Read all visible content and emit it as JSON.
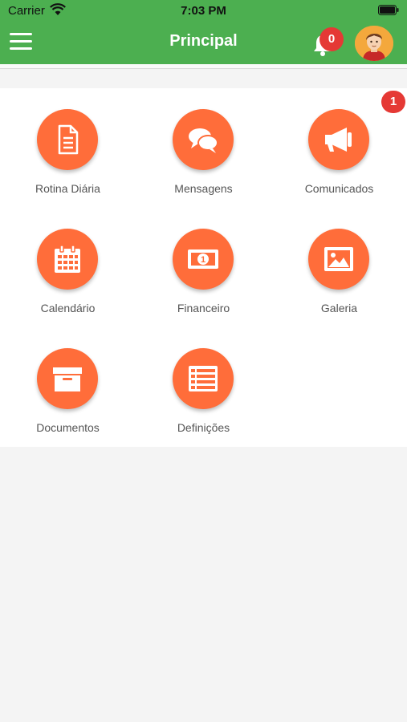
{
  "status_bar": {
    "carrier": "Carrier",
    "time": "7:03 PM"
  },
  "nav": {
    "title": "Principal",
    "notification_count": "0"
  },
  "colors": {
    "header_green": "#4caf50",
    "tile_orange": "#ff6d3a",
    "badge_red": "#e53935"
  },
  "panel_badge": "1",
  "tiles": [
    {
      "label": "Rotina Diária",
      "icon": "document-icon"
    },
    {
      "label": "Mensagens",
      "icon": "chat-bubbles-icon"
    },
    {
      "label": "Comunicados",
      "icon": "megaphone-icon"
    },
    {
      "label": "Calendário",
      "icon": "calendar-icon"
    },
    {
      "label": "Financeiro",
      "icon": "banknote-icon"
    },
    {
      "label": "Galeria",
      "icon": "image-icon"
    },
    {
      "label": "Documentos",
      "icon": "archive-box-icon"
    },
    {
      "label": "Definições",
      "icon": "list-icon"
    }
  ]
}
